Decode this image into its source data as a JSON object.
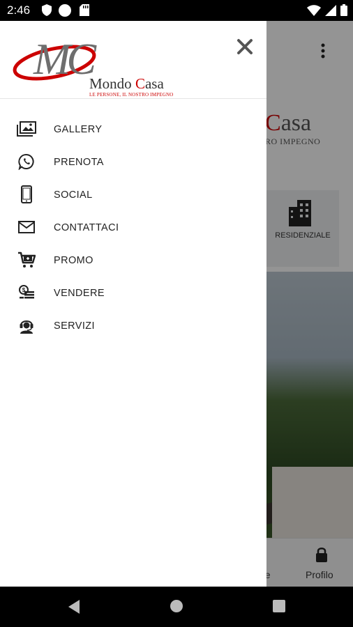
{
  "status_bar": {
    "time": "2:46",
    "icons": [
      "shield-icon",
      "circle-icon",
      "sd-card-icon",
      "wifi-icon",
      "signal-icon",
      "battery-icon"
    ]
  },
  "background_app": {
    "logo_text_red": "C",
    "logo_text_rest": "asa",
    "logo_subtitle": "RO IMPEGNO",
    "tile_label": "RESIDENZIALE",
    "bottom_nav": {
      "partial_label": "ne",
      "profile_label": "Profilo"
    }
  },
  "drawer": {
    "logo": {
      "monogram": "MC",
      "name_part1": "Mondo",
      "name_c": "C",
      "name_part2": "asa",
      "tagline": "LE PERSONE, IL NOSTRO IMPEGNO"
    },
    "close_icon": "close-icon",
    "menu": [
      {
        "label": "GALLERY",
        "icon": "gallery-icon"
      },
      {
        "label": "PRENOTA",
        "icon": "whatsapp-icon"
      },
      {
        "label": "SOCIAL",
        "icon": "smartphone-icon"
      },
      {
        "label": "CONTATTACI",
        "icon": "envelope-icon"
      },
      {
        "label": "PROMO",
        "icon": "cart-icon"
      },
      {
        "label": "VENDERE",
        "icon": "money-icon"
      },
      {
        "label": "SERVIZI",
        "icon": "support-agent-icon"
      }
    ]
  },
  "colors": {
    "brand_red": "#cc0000",
    "drawer_bg": "#ffffff",
    "scrim": "rgba(0,0,0,0.42)"
  }
}
